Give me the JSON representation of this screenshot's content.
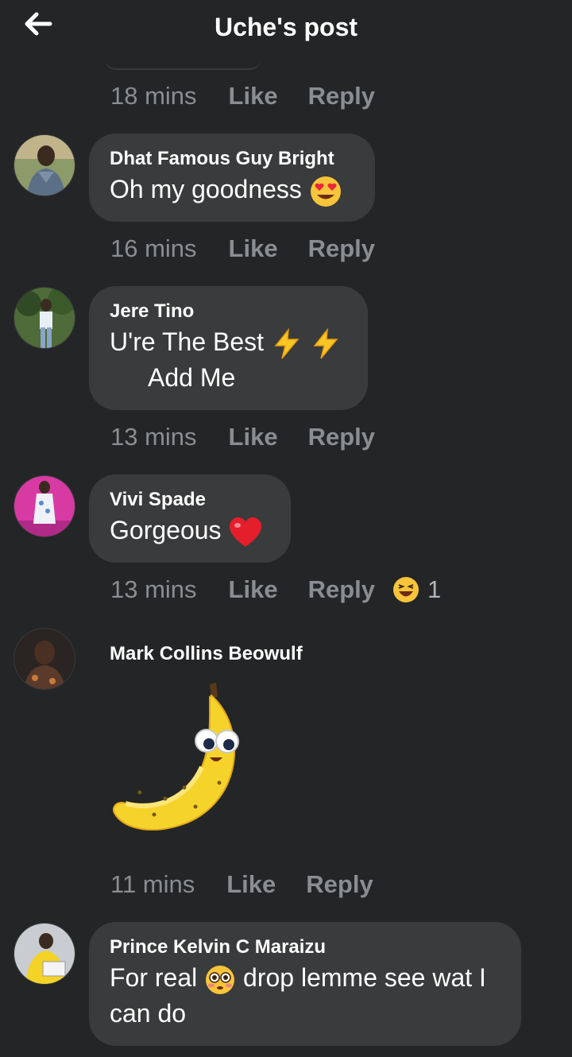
{
  "header": {
    "title": "Uche's post"
  },
  "top_meta": {
    "time": "18 mins",
    "like": "Like",
    "reply": "Reply"
  },
  "comments": [
    {
      "author": "Dhat Famous Guy Bright",
      "text": "Oh my goodness",
      "emoji": "heart-eyes-emoji",
      "time": "16 mins",
      "like": "Like",
      "reply": "Reply"
    },
    {
      "author": "Jere Tino",
      "text_line1": "U're The Best",
      "text_line2": "Add Me",
      "emoji": "lightning-emoji",
      "time": "13 mins",
      "like": "Like",
      "reply": "Reply"
    },
    {
      "author": "Vivi Spade",
      "text": "Gorgeous",
      "emoji": "red-heart-emoji",
      "time": "13 mins",
      "like": "Like",
      "reply": "Reply",
      "reaction_icon": "laughing-emoji",
      "reaction_count": "1"
    },
    {
      "author": "Mark Collins Beowulf",
      "sticker": "banana-sticker",
      "time": "11 mins",
      "like": "Like",
      "reply": "Reply"
    },
    {
      "author": "Prince Kelvin C Maraizu",
      "text_before": "For real",
      "text_after": "drop lemme see wat I",
      "text_line2": "can do",
      "emoji": "flushed-emoji"
    }
  ],
  "colors": {
    "background": "#242526",
    "bubble": "#3a3b3c",
    "meta_text": "#8a8d91",
    "primary_text": "#ffffff"
  }
}
